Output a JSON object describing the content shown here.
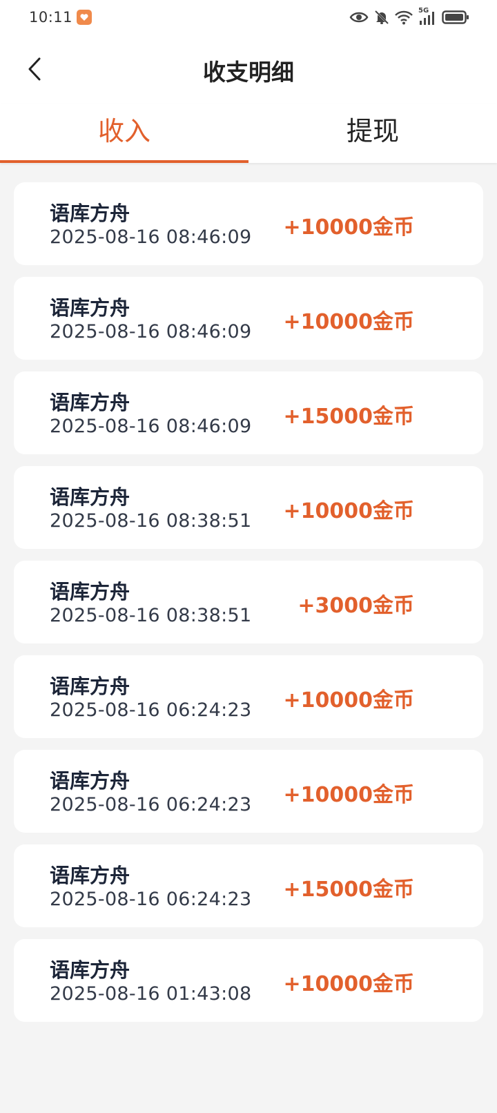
{
  "status_bar": {
    "time": "10:11",
    "network_label": "5G"
  },
  "header": {
    "title": "收支明细"
  },
  "tabs": [
    {
      "label": "收入",
      "active": true
    },
    {
      "label": "提现",
      "active": false
    }
  ],
  "colors": {
    "accent": "#e2602c",
    "background": "#f4f4f4",
    "card": "#ffffff",
    "primary_text": "#1c2538"
  },
  "records": [
    {
      "source": "语库方舟",
      "time": "2025-08-16 08:46:09",
      "amount": "+10000金币"
    },
    {
      "source": "语库方舟",
      "time": "2025-08-16 08:46:09",
      "amount": "+10000金币"
    },
    {
      "source": "语库方舟",
      "time": "2025-08-16 08:46:09",
      "amount": "+15000金币"
    },
    {
      "source": "语库方舟",
      "time": "2025-08-16 08:38:51",
      "amount": "+10000金币"
    },
    {
      "source": "语库方舟",
      "time": "2025-08-16 08:38:51",
      "amount": "+3000金币"
    },
    {
      "source": "语库方舟",
      "time": "2025-08-16 06:24:23",
      "amount": "+10000金币"
    },
    {
      "source": "语库方舟",
      "time": "2025-08-16 06:24:23",
      "amount": "+10000金币"
    },
    {
      "source": "语库方舟",
      "time": "2025-08-16 06:24:23",
      "amount": "+15000金币"
    },
    {
      "source": "语库方舟",
      "time": "2025-08-16 01:43:08",
      "amount": "+10000金币"
    }
  ]
}
